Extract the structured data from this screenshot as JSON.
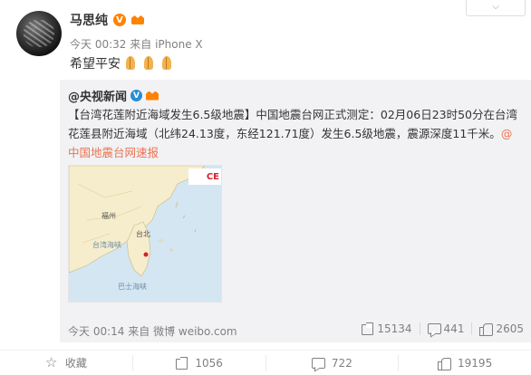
{
  "post": {
    "author": "马思纯",
    "vip_badge": "V",
    "time": "今天 00:32",
    "source_prefix": "来自",
    "source": "iPhone X",
    "text": "希望平安",
    "emoji": "pray-emoji",
    "dropdown_icon": "chevron-down-icon"
  },
  "repost": {
    "author": "@央视新闻",
    "verified_badge": "V",
    "text": "【台湾花莲附近海域发生6.5级地震】中国地震台网正式测定：02月06日23时50分在台湾花莲县附近海域（北纬24.13度，东经121.71度）发生6.5级地震，震源深度11千米。",
    "mention": "@中国地震台网速报",
    "map": {
      "logo_text": "CE",
      "labels": [
        "台北",
        "福州",
        "台湾海峡",
        "巴士海峡"
      ]
    },
    "time": "今天 00:14",
    "source_prefix": "来自",
    "source": "微博 weibo.com",
    "reposts": "15134",
    "comments": "441",
    "likes": "2605"
  },
  "footer": {
    "favorite_label": "收藏",
    "share_count": "1056",
    "comment_count": "722",
    "like_count": "19195"
  },
  "colors": {
    "link": "#eb7350",
    "vip": "#ff8200",
    "verified": "#2a8dd4",
    "repost_bg": "#f2f2f5"
  }
}
